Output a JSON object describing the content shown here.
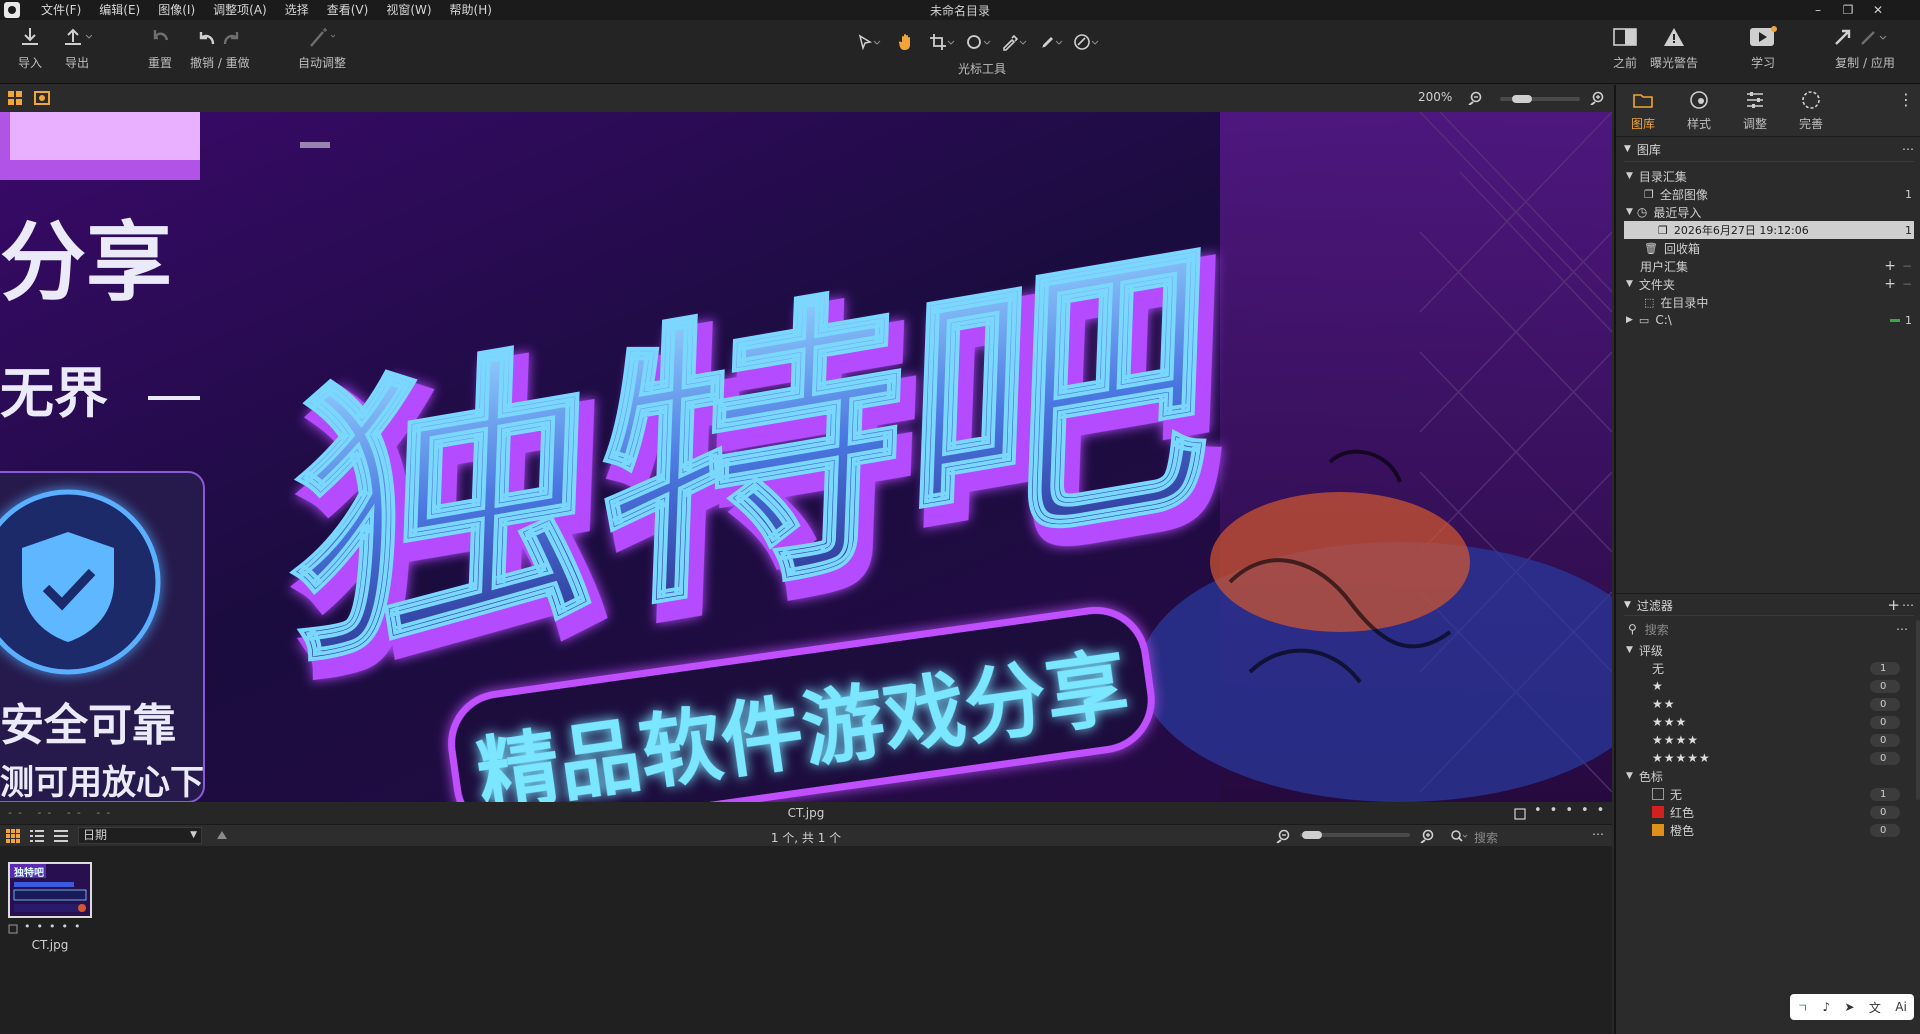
{
  "window": {
    "title": "未命名目录"
  },
  "menu": [
    "文件(F)",
    "编辑(E)",
    "图像(I)",
    "调整项(A)",
    "选择",
    "查看(V)",
    "视窗(W)",
    "帮助(H)"
  ],
  "toolbar": {
    "import": "导入",
    "export": "导出",
    "reset": "重置",
    "undo_redo": "撤销 / 重做",
    "auto_adjust": "自动调整",
    "cursor_tools": "光标工具",
    "before": "之前",
    "exposure_warning": "曝光警告",
    "learn": "学习",
    "copy_apply": "复制 / 应用"
  },
  "viewer": {
    "zoom": "200%",
    "filename": "CT.jpg",
    "image_text": {
      "left_top": "分享",
      "left_mid": "无界",
      "left_bottom1": "安全可靠",
      "left_bottom2": "测可用放心下",
      "headline": "独特吧",
      "banner": "精品软件游戏分享"
    }
  },
  "browser": {
    "sort_label": "日期",
    "count": "1 个, 共 1 个",
    "search_placeholder": "搜索",
    "thumbnails": [
      {
        "name": "CT.jpg"
      }
    ]
  },
  "right_panel": {
    "tabs": [
      {
        "label": "图库",
        "icon": "folder-icon",
        "active": true
      },
      {
        "label": "样式",
        "icon": "styles-icon",
        "active": false
      },
      {
        "label": "调整",
        "icon": "sliders-icon",
        "active": false
      },
      {
        "label": "完善",
        "icon": "refine-icon",
        "active": false
      }
    ],
    "library": {
      "title": "图库",
      "catalog_collection": "目录汇集",
      "all_images": "全部图像",
      "all_images_count": "1",
      "recent_imports": "最近导入",
      "import_date": "2026年6月27日 19:12:06",
      "import_count": "1",
      "trash": "回收箱",
      "user_collections": "用户汇集",
      "folders": "文件夹",
      "in_catalog": "在目录中",
      "drive": "C:\\",
      "drive_count": "1"
    },
    "filters": {
      "title": "过滤器",
      "search_placeholder": "搜索",
      "rating_title": "评级",
      "ratings": [
        {
          "label": "无",
          "count": "1"
        },
        {
          "label": "★",
          "count": "0"
        },
        {
          "label": "★★",
          "count": "0"
        },
        {
          "label": "★★★",
          "count": "0"
        },
        {
          "label": "★★★★",
          "count": "0"
        },
        {
          "label": "★★★★★",
          "count": "0"
        }
      ],
      "color_title": "色标",
      "colors": [
        {
          "label": "无",
          "count": "1",
          "color": "#2b2b2b"
        },
        {
          "label": "红色",
          "count": "0",
          "color": "#d0211f"
        },
        {
          "label": "橙色",
          "count": "0",
          "color": "#e0901a"
        }
      ]
    }
  },
  "colors": {
    "accent": "#f0a43a",
    "neon_purple": "#b54cff",
    "neon_cyan": "#5fd6ff"
  }
}
